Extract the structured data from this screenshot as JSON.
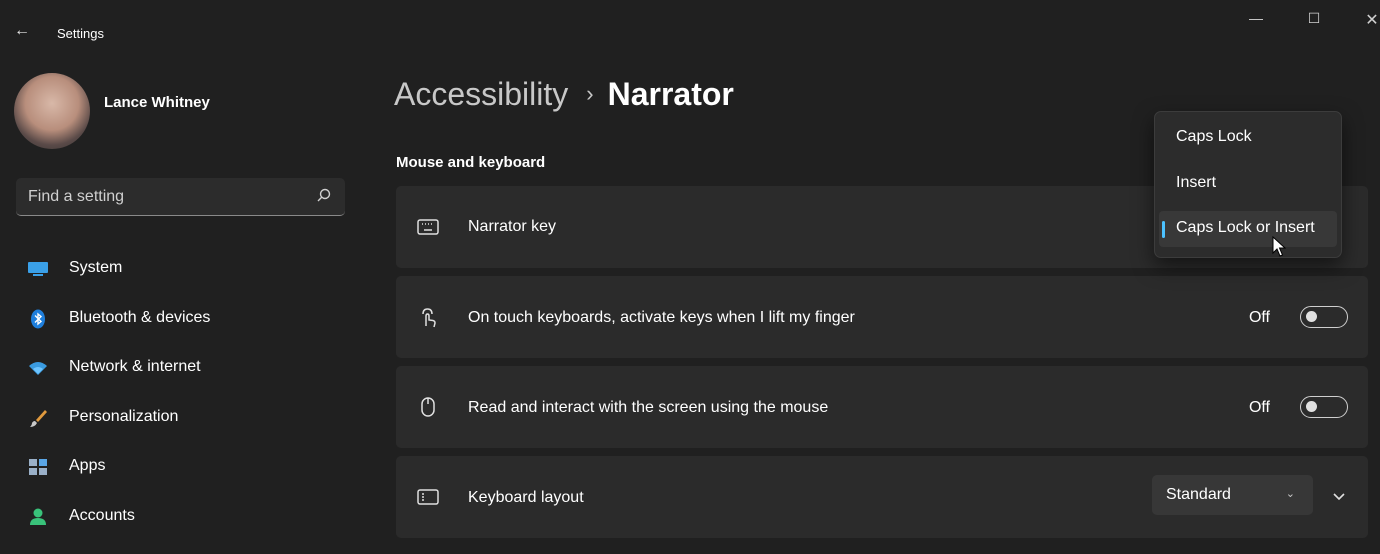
{
  "window": {
    "app_title": "Settings",
    "back_glyph": "←",
    "controls": {
      "minimize": "—",
      "maximize": "☐",
      "close": "✕"
    }
  },
  "user": {
    "name": "Lance Whitney"
  },
  "search": {
    "placeholder": "Find a setting"
  },
  "sidebar": {
    "items": [
      {
        "label": "System",
        "icon": "system-icon"
      },
      {
        "label": "Bluetooth & devices",
        "icon": "bluetooth-icon"
      },
      {
        "label": "Network & internet",
        "icon": "network-icon"
      },
      {
        "label": "Personalization",
        "icon": "brush-icon"
      },
      {
        "label": "Apps",
        "icon": "apps-icon"
      },
      {
        "label": "Accounts",
        "icon": "accounts-icon"
      }
    ]
  },
  "breadcrumb": {
    "parent": "Accessibility",
    "separator": "›",
    "current": "Narrator"
  },
  "section": {
    "title": "Mouse and keyboard"
  },
  "settings": {
    "narrator_key": {
      "label": "Narrator key",
      "icon": "keyboard-icon"
    },
    "touch_keys": {
      "label": "On touch keyboards, activate keys when I lift my finger",
      "state": "Off",
      "icon": "touch-icon"
    },
    "mouse_read": {
      "label": "Read and interact with the screen using the mouse",
      "state": "Off",
      "icon": "mouse-icon"
    },
    "keyboard_layout": {
      "label": "Keyboard layout",
      "value": "Standard",
      "icon": "keyboard-layout-icon"
    }
  },
  "dropdown_popup": {
    "options": [
      "Caps Lock",
      "Insert",
      "Caps Lock or Insert"
    ],
    "selected": "Caps Lock or Insert"
  },
  "colors": {
    "background": "#202020",
    "card": "#2b2b2b",
    "accent": "#4cc2ff"
  }
}
